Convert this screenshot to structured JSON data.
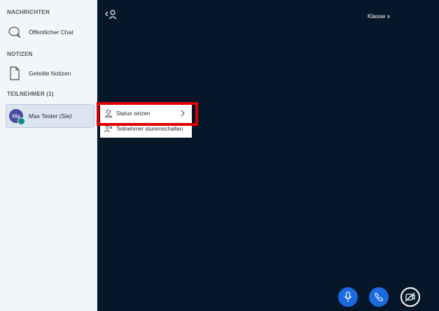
{
  "sidebar": {
    "messages_header": "NACHRICHTEN",
    "public_chat_label": "Öffentlicher Chat",
    "notes_header": "NOTIZEN",
    "shared_notes_label": "Geteilte Notizen",
    "participants_header": "TEILNEHMER (1)",
    "user": {
      "initials": "Ma",
      "name": "Max Tester",
      "you_suffix": "(Sie)"
    }
  },
  "main": {
    "room_title": "Klasse x"
  },
  "context_menu": {
    "items": [
      {
        "label": "Status setzen",
        "icon": "user-icon",
        "has_submenu": true
      },
      {
        "label": "Teilnehmer stummschalten",
        "icon": "mute-icon",
        "has_submenu": false
      }
    ]
  },
  "controls": {
    "microphone": "microphone-icon",
    "phone": "phone-icon",
    "camera": "camera-off-icon"
  },
  "colors": {
    "sidebar_bg": "#f3f6f9",
    "main_bg": "#06172a",
    "accent_blue": "#1b6be0",
    "highlight_red": "#e00000"
  }
}
